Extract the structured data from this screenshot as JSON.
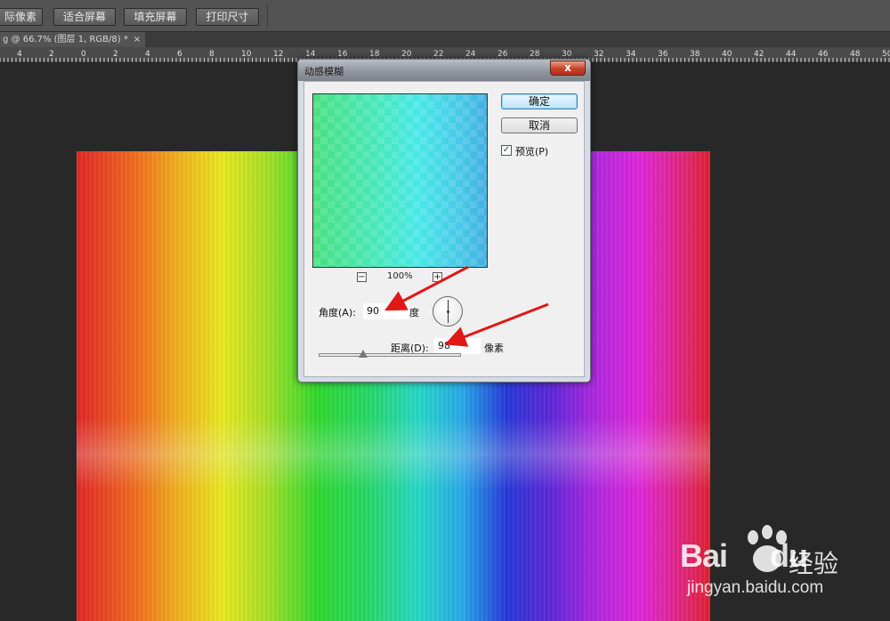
{
  "toolbar": {
    "buttons": [
      {
        "label": "际像素"
      },
      {
        "label": "适合屏幕"
      },
      {
        "label": "填充屏幕"
      },
      {
        "label": "打印尺寸"
      }
    ]
  },
  "document_tab": {
    "label": "g @ 66.7% (图层 1, RGB/8) *",
    "close": "×"
  },
  "ruler": {
    "ticks": [
      "4",
      "2",
      "0",
      "2",
      "4",
      "6",
      "8",
      "10",
      "12",
      "14",
      "16",
      "18",
      "20",
      "22",
      "24",
      "26",
      "28",
      "30",
      "32",
      "34",
      "36",
      "38",
      "40",
      "42",
      "44",
      "46",
      "48",
      "50"
    ]
  },
  "dialog": {
    "title": "动感模糊",
    "close": "x",
    "ok_label": "确定",
    "cancel_label": "取消",
    "preview_checked": "✓",
    "preview_label": "预览(P)",
    "zoom_out": "−",
    "zoom_level": "100%",
    "zoom_in": "+",
    "angle_label": "角度(A):",
    "angle_value": "90",
    "angle_unit": "度",
    "distance_label": "距离(D):",
    "distance_value": "98",
    "distance_unit": "像素",
    "distance_slider_fraction": 0.31
  },
  "colors": {
    "annotation_arrow": "#e01818",
    "ok_border": "#3c7fb1"
  },
  "watermark": {
    "logo": "Bai",
    "logo_tail": "du",
    "brand_cn": "经验",
    "url": "jingyan.baidu.com"
  }
}
